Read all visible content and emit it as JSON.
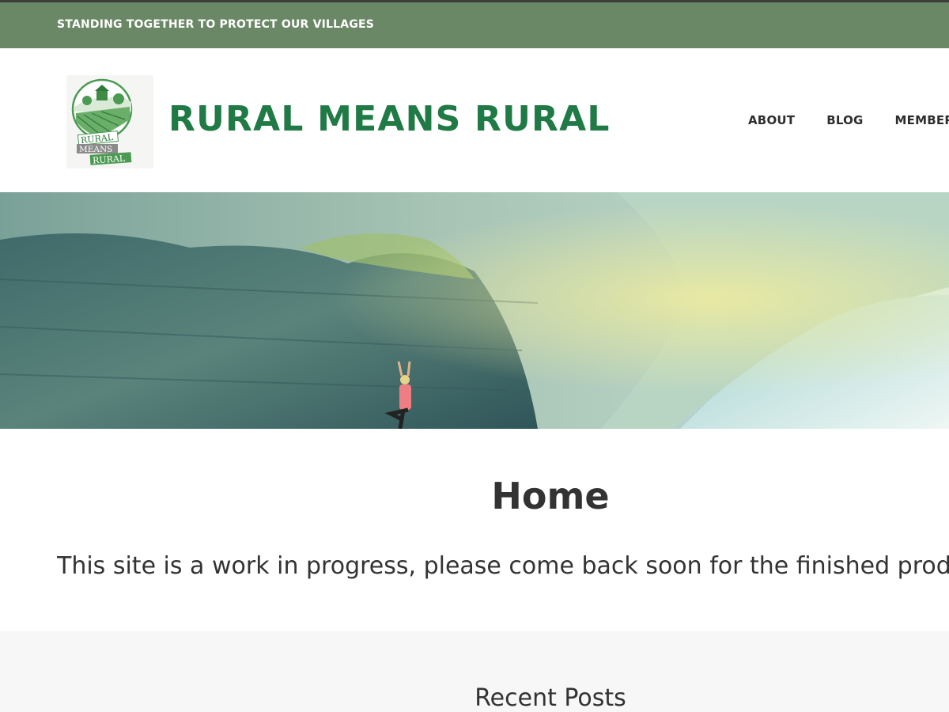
{
  "topbar": {
    "tagline": "STANDING TOGETHER TO PROTECT OUR VILLAGES"
  },
  "header": {
    "logo": {
      "line1": "RURAL",
      "line2": "MEANS",
      "line3": "RURAL"
    },
    "site_title": "RURAL MEANS RURAL",
    "nav": [
      "ABOUT",
      "BLOG",
      "MEMBERS"
    ]
  },
  "hero": {
    "alt": "woman in yoga tree pose on cliff above fjord"
  },
  "main": {
    "page_title": "Home",
    "intro": "This site is a work in progress, please come back soon for the finished product."
  },
  "footer": {
    "widget_title": "Recent Posts"
  },
  "colors": {
    "topbar": "#6b8866",
    "brand": "#1f7a45",
    "text": "#333333"
  }
}
